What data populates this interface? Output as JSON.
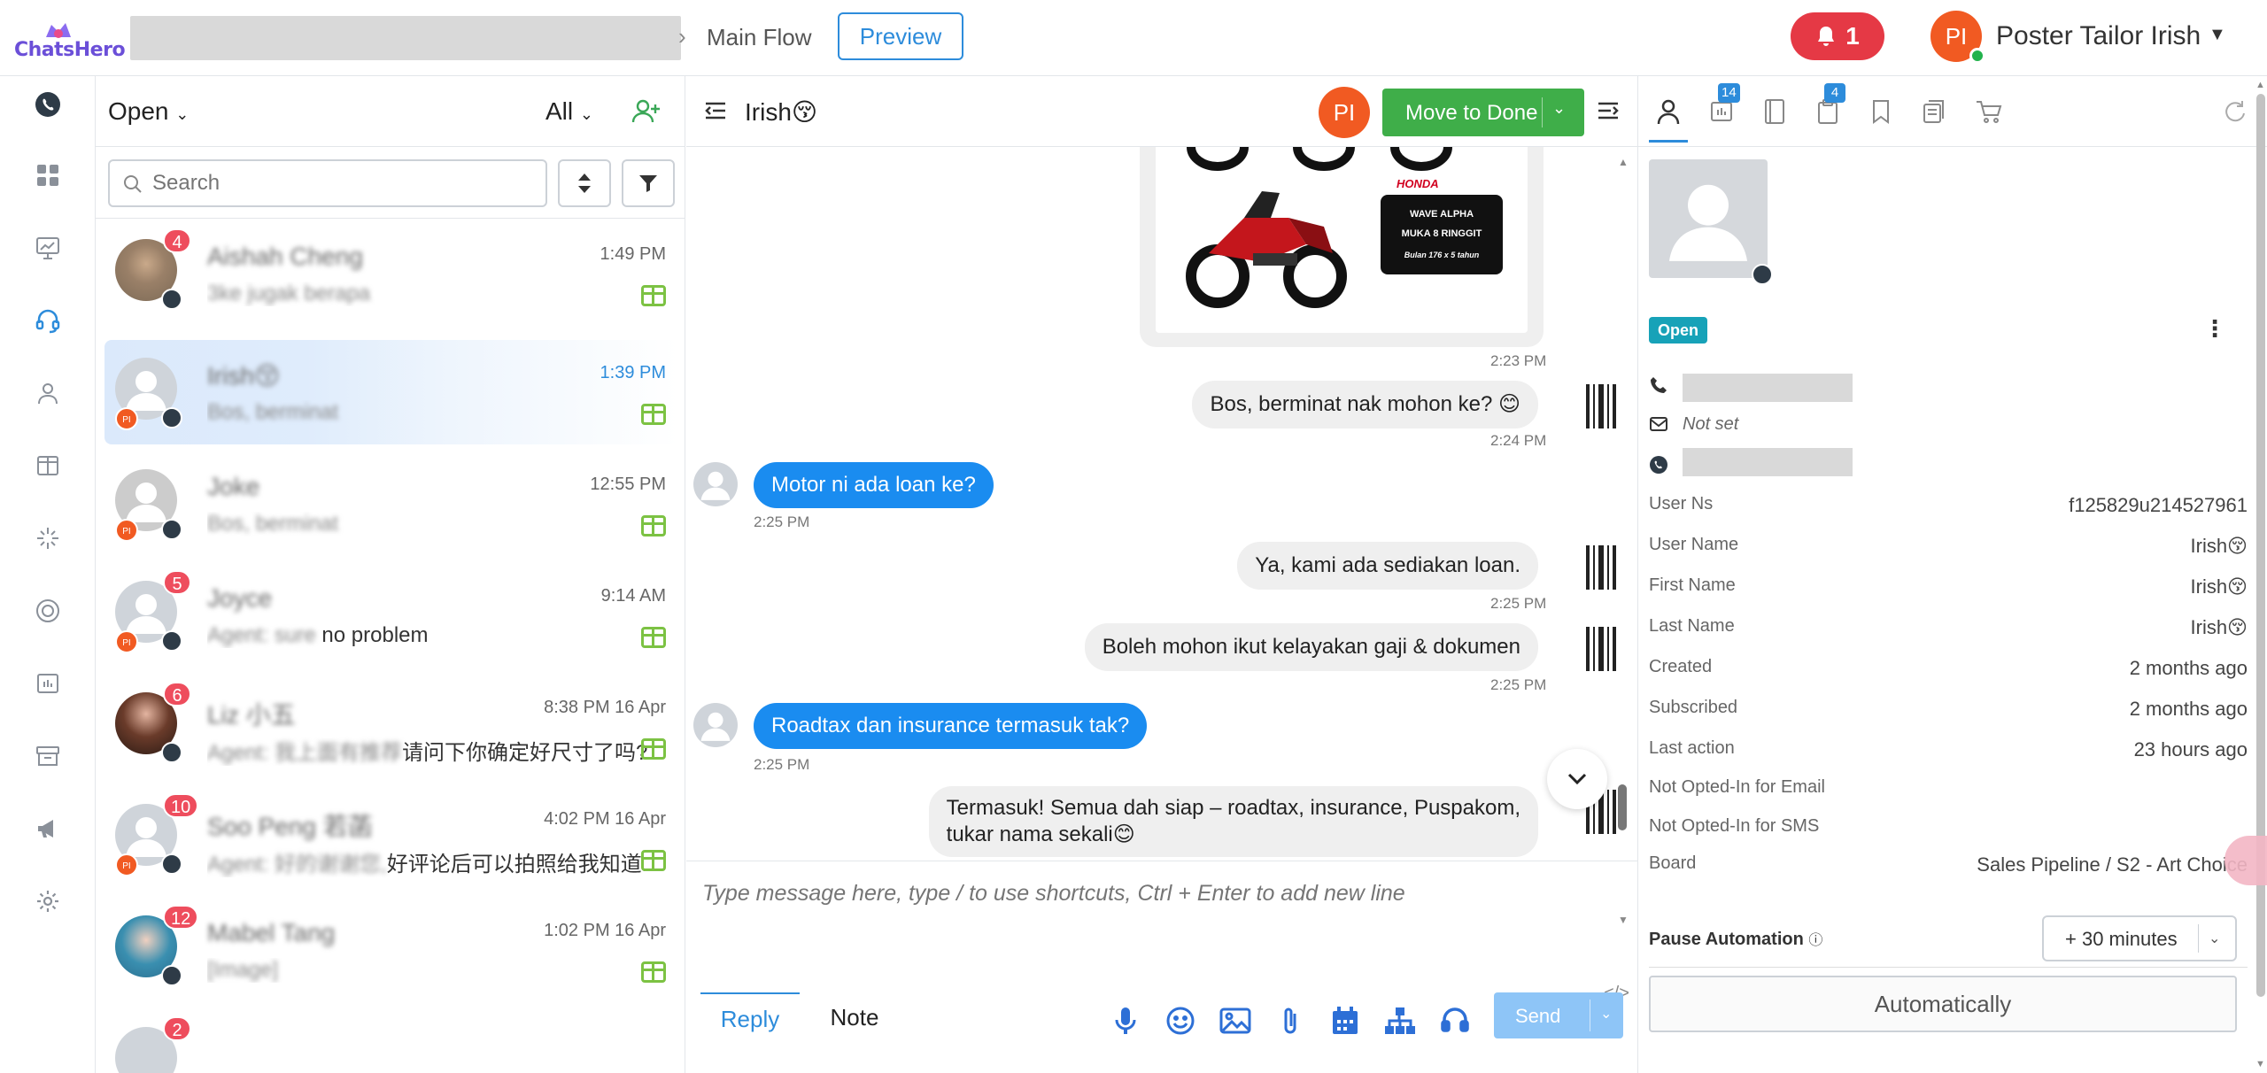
{
  "brand": {
    "name": "ChatsHero",
    "color": "#6b4fd8"
  },
  "header": {
    "breadcrumb_current": "Main Flow",
    "preview_label": "Preview",
    "notifications_count": "1",
    "user_initials": "PI",
    "user_name": "Poster Tailor Irish"
  },
  "sidebar": {
    "icons": [
      "whatsapp-icon",
      "dashboard-icon",
      "chart-icon",
      "headset-icon",
      "user-icon",
      "board-icon",
      "sparkle-icon",
      "target-icon",
      "report-icon",
      "archive-icon",
      "megaphone-icon",
      "settings-icon"
    ]
  },
  "list": {
    "status_filter": "Open",
    "scope_filter": "All",
    "search_placeholder": "Search",
    "conversations": [
      {
        "name": "Aishah Cheng",
        "preview": "3ke jugak berapa",
        "time": "1:49 PM",
        "badge": "4",
        "active": false
      },
      {
        "name": "Irish😚",
        "preview": "Bos, berminat",
        "time": "1:39 PM",
        "badge": "",
        "active": true
      },
      {
        "name": "Joke",
        "preview": "Bos, berminat",
        "time": "12:55 PM",
        "badge": "",
        "active": false
      },
      {
        "name": "Joyce",
        "preview_blur": "Agent: sure",
        "preview_clear": "no problem",
        "time": "9:14 AM",
        "badge": "5",
        "active": false
      },
      {
        "name": "Liz 小五",
        "preview_blur": "Agent: 我上面有推荐",
        "preview_clear": "请问下你确定好尺寸了吗?",
        "time": "8:38 PM 16 Apr",
        "badge": "6",
        "active": false
      },
      {
        "name": "Soo Peng 若菡",
        "preview_blur": "Agent: 好的谢谢您,",
        "preview_clear": "好评论后可以拍照给我知道...",
        "time": "4:02 PM 16 Apr",
        "badge": "10",
        "active": false
      },
      {
        "name": "Mabel Tang",
        "preview": "[Image]",
        "time": "1:02 PM 16 Apr",
        "badge": "12",
        "active": false
      },
      {
        "name": "",
        "preview": "",
        "time": "",
        "badge": "2",
        "active": false
      }
    ]
  },
  "chat": {
    "contact_name": "Irish😚",
    "agent_initials": "PI",
    "move_to_done_label": "Move to Done",
    "image_card": {
      "brand": "HONDA",
      "line1": "WAVE ALPHA",
      "line2": "MUKA 8 RINGGIT",
      "line3": "Bulan 176 x 5 tahun"
    },
    "messages": [
      {
        "dir": "out",
        "text": "",
        "time": "2:23 PM"
      },
      {
        "dir": "out",
        "text": "Bos, berminat nak mohon ke? 😊",
        "time": "2:24 PM"
      },
      {
        "dir": "in",
        "text": "Motor ni ada loan ke?",
        "time": "2:25 PM"
      },
      {
        "dir": "out",
        "text": "Ya, kami ada sediakan loan.",
        "time": "2:25 PM"
      },
      {
        "dir": "out",
        "text": "Boleh mohon ikut kelayakan gaji & dokumen",
        "time": "2:25 PM"
      },
      {
        "dir": "in",
        "text": "Roadtax dan insurance termasuk tak?",
        "time": "2:25 PM"
      },
      {
        "dir": "out",
        "text": "Termasuk! Semua dah siap – roadtax, insurance, Puspakom,",
        "text2": "tukar nama sekali😊",
        "time": ""
      }
    ],
    "composer": {
      "placeholder": "Type message here, type / to use shortcuts, Ctrl + Enter to add new line",
      "tab_reply": "Reply",
      "tab_note": "Note",
      "send_label": "Send"
    }
  },
  "profile": {
    "tab_badges": {
      "messages": "14",
      "tags": "4"
    },
    "status": "Open",
    "email": "Not set",
    "attributes": [
      {
        "label": "User Ns",
        "value": "f125829u214527961"
      },
      {
        "label": "User Name",
        "value": "Irish😚"
      },
      {
        "label": "First Name",
        "value": "Irish😚"
      },
      {
        "label": "Last Name",
        "value": "Irish😚"
      },
      {
        "label": "Created",
        "value": "2 months ago"
      },
      {
        "label": "Subscribed",
        "value": "2 months ago"
      },
      {
        "label": "Last action",
        "value": "23 hours ago"
      },
      {
        "label": "Not Opted-In for Email",
        "value": ""
      },
      {
        "label": "Not Opted-In for SMS",
        "value": ""
      },
      {
        "label": "Board",
        "value": "Sales Pipeline / S2 - Art Choice"
      }
    ],
    "pause_automation_label": "Pause Automation",
    "pause_value": "+ 30 minutes",
    "automatically_label": "Automatically"
  },
  "colors": {
    "accent": "#2d8cdb",
    "success": "#3fae49",
    "danger": "#e53945",
    "avatar_orange": "#f15a22",
    "incoming_bubble": "#1a8cf0"
  }
}
